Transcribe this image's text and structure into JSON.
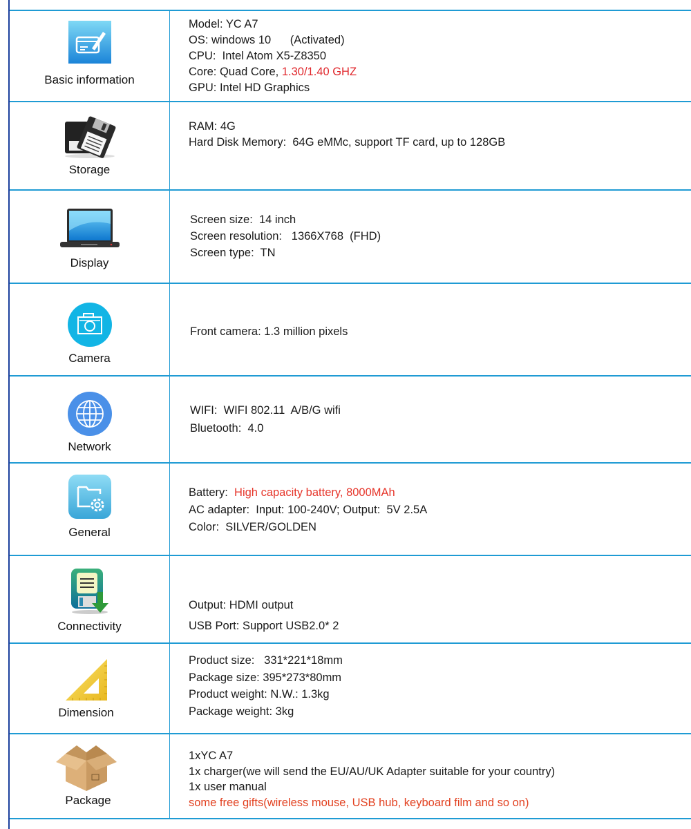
{
  "colors": {
    "border": "#1f9bd4",
    "frame": "#1b3f9c",
    "highlight_red": "#e0262b",
    "highlight_orange": "#e2401f"
  },
  "rows": [
    {
      "category": "Basic information",
      "icon": "edit-card-icon",
      "lines": [
        {
          "label": "Model",
          "sep": ": ",
          "value": "YC A7"
        },
        {
          "label": "OS",
          "sep": ": ",
          "value": "windows 10      (Activated)"
        },
        {
          "label": "CPU",
          "sep": ":  ",
          "value": "Intel Atom X5-Z8350"
        },
        {
          "label": "Core",
          "sep": ": ",
          "value": "Quad Core, ",
          "highlight": "1.30/1.40 GHZ"
        },
        {
          "label": "GPU",
          "sep": ": ",
          "value": "Intel HD Graphics"
        }
      ]
    },
    {
      "category": "Storage",
      "icon": "floppy-disk-icon",
      "lines": [
        {
          "label": "RAM",
          "sep": ": ",
          "value": "4G"
        },
        {
          "label": "Hard Disk Memory",
          "sep": ":  ",
          "value": "64G eMMc, support TF card, up to 128GB"
        }
      ]
    },
    {
      "category": "Display",
      "icon": "laptop-icon",
      "lines": [
        {
          "label": "Screen size",
          "sep": ":  ",
          "value": "14 inch"
        },
        {
          "label": "Screen resolution",
          "sep": ":   ",
          "value": "1366X768  (FHD)"
        },
        {
          "label": "Screen type",
          "sep": ":  ",
          "value": "TN"
        }
      ]
    },
    {
      "category": "Camera",
      "icon": "camera-icon",
      "lines": [
        {
          "label": "Front camera",
          "sep": ": ",
          "value": "1.3 million pixels"
        }
      ]
    },
    {
      "category": "Network",
      "icon": "globe-icon",
      "lines": [
        {
          "label": "WIFI",
          "sep": ":  ",
          "value": "WIFI 802.11  A/B/G wifi"
        },
        {
          "label": "Bluetooth",
          "sep": ":  ",
          "value": "4.0"
        }
      ]
    },
    {
      "category": "General",
      "icon": "folder-settings-icon",
      "lines": [
        {
          "label": "Battery",
          "sep": ":  ",
          "value": "",
          "highlight": "High capacity battery, 8000MAh"
        },
        {
          "label": "AC adapter",
          "sep": ":  ",
          "value": "Input: 100-240V; Output:  5V 2.5A"
        },
        {
          "label": "Color",
          "sep": ":  ",
          "value": "SILVER/GOLDEN"
        }
      ]
    },
    {
      "category": "Connectivity",
      "icon": "download-document-icon",
      "lines": [
        {
          "label": "Output",
          "sep": ": ",
          "value": "HDMI output"
        },
        {
          "label": "USB Port",
          "sep": ": ",
          "value": "Support USB2.0* 2"
        }
      ]
    },
    {
      "category": "Dimension",
      "icon": "set-square-ruler-icon",
      "lines": [
        {
          "label": "Product size",
          "sep": ":   ",
          "value": "331*221*18mm"
        },
        {
          "label": "Package size",
          "sep": ": ",
          "value": "395*273*80mm"
        },
        {
          "label": "Product weight",
          "sep": ": ",
          "value": "N.W.: 1.3kg"
        },
        {
          "label": "Package weight",
          "sep": ": ",
          "value": "3kg"
        }
      ]
    },
    {
      "category": "Package",
      "icon": "cardboard-box-icon",
      "lines": [
        {
          "text": "1xYC A7"
        },
        {
          "text": "1x charger(we will send the EU/AU/UK Adapter suitable for your country)"
        },
        {
          "text": "1x user manual"
        },
        {
          "text": "some free gifts(wireless mouse, USB hub, keyboard film and so on)",
          "highlight_line": true
        }
      ]
    }
  ]
}
